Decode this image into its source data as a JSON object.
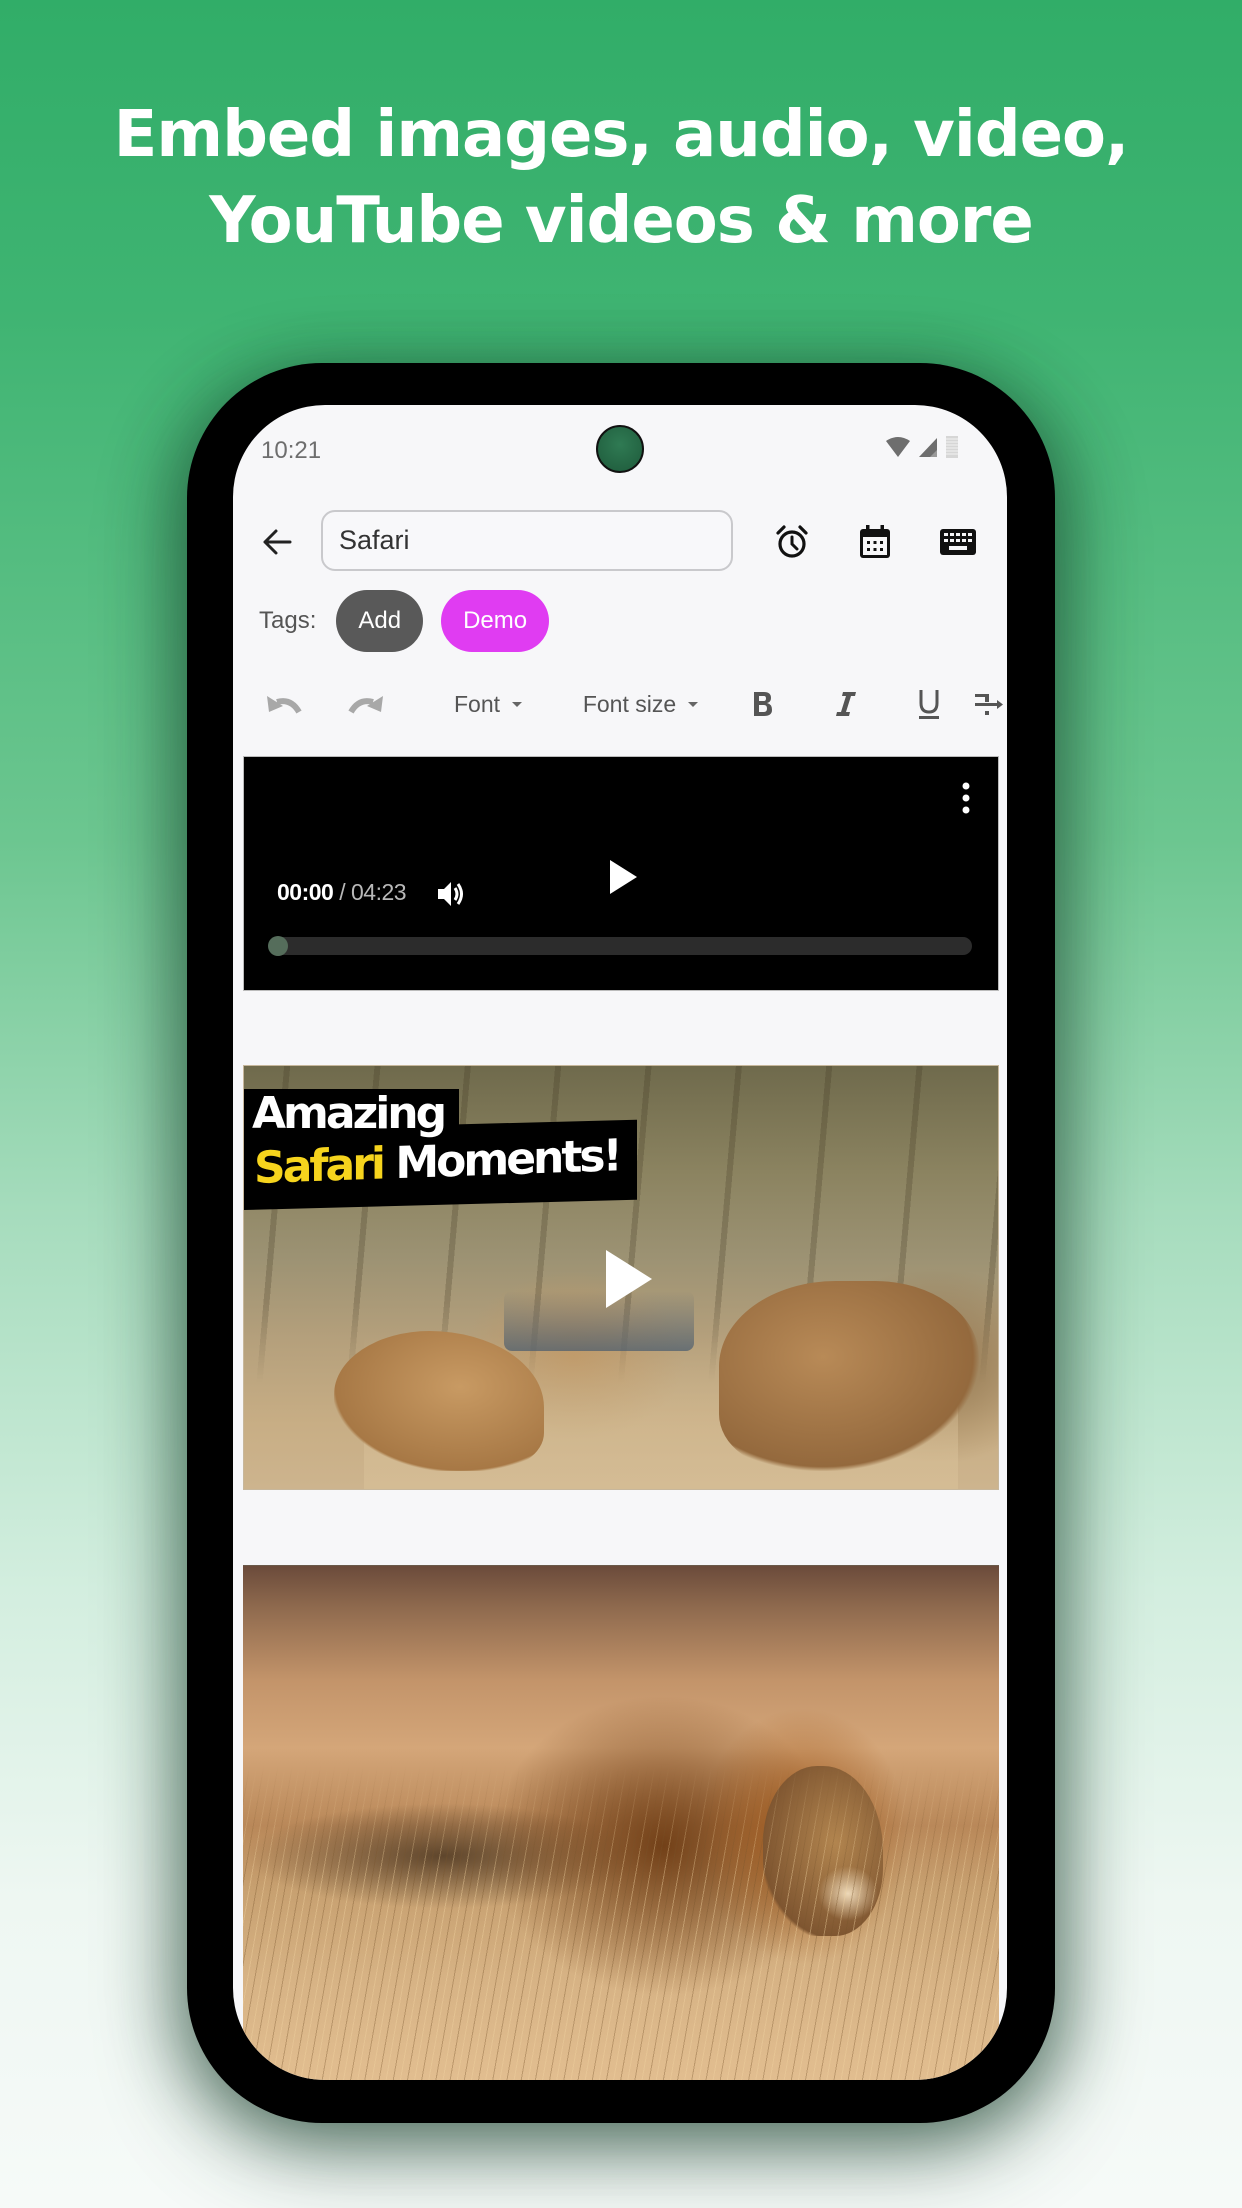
{
  "headline": {
    "line1": "Embed images, audio, video,",
    "line2": "YouTube videos & more"
  },
  "status_bar": {
    "time": "10:21",
    "icons": [
      "wifi-icon",
      "cellular-signal-icon",
      "battery-icon"
    ]
  },
  "app_bar": {
    "back_icon": "arrow-left-icon",
    "title_value": "Safari",
    "actions": [
      {
        "name": "reminder",
        "icon": "alarm-clock-icon"
      },
      {
        "name": "date",
        "icon": "calendar-icon"
      },
      {
        "name": "keyboard",
        "icon": "keyboard-icon"
      }
    ]
  },
  "tags": {
    "label": "Tags:",
    "chips": [
      {
        "label": "Add",
        "color": "#595959"
      },
      {
        "label": "Demo",
        "color": "#e03cf2"
      }
    ]
  },
  "toolbar": {
    "undo_icon": "undo-icon",
    "redo_icon": "redo-icon",
    "font_label": "Font",
    "font_size_label": "Font size",
    "bold_icon": "bold-icon",
    "italic_icon": "italic-icon",
    "underline_icon": "underline-icon",
    "more_icon": "text-direction-icon"
  },
  "media_player": {
    "current_time": "00:00",
    "separator": "/",
    "duration": "04:23",
    "progress_fraction": 0.0,
    "play_icon": "play-icon",
    "volume_icon": "volume-icon",
    "menu_icon": "more-vert-icon"
  },
  "youtube_embed": {
    "thumbnail_title_line1": "Amazing",
    "thumbnail_title_highlight": "Safari",
    "thumbnail_title_rest": "Moments!",
    "highlight_color": "#f6d41d",
    "play_icon": "play-icon"
  },
  "image_embed": {
    "description": "Lion resting in tall golden grass"
  },
  "colors": {
    "background_top": "#31ad68",
    "background_bottom": "#f6faf8",
    "accent_chip": "#e03cf2"
  }
}
